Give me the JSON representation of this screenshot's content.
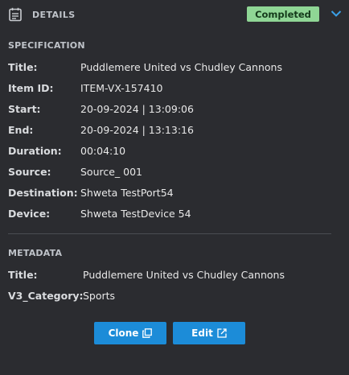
{
  "header": {
    "title": "DETAILS",
    "status": "Completed",
    "icon": "details-document-icon",
    "collapse_icon": "chevron-down-icon"
  },
  "specification": {
    "section_title": "SPECIFICATION",
    "rows": [
      {
        "label": "Title:",
        "value": "Puddlemere United vs Chudley Cannons"
      },
      {
        "label": "Item ID:",
        "value": "ITEM-VX-157410"
      },
      {
        "label": "Start:",
        "value": "20-09-2024 | 13:09:06"
      },
      {
        "label": "End:",
        "value": "20-09-2024 | 13:13:16"
      },
      {
        "label": "Duration:",
        "value": "00:04:10"
      },
      {
        "label": "Source:",
        "value": "Source_ 001"
      },
      {
        "label": "Destination:",
        "value": "Shweta TestPort54"
      },
      {
        "label": "Device:",
        "value": "Shweta TestDevice 54"
      }
    ]
  },
  "metadata": {
    "section_title": "METADATA",
    "rows": [
      {
        "label": "Title:",
        "value": "Puddlemere United vs Chudley Cannons"
      },
      {
        "label": "V3_Category:",
        "value": "Sports"
      }
    ]
  },
  "actions": {
    "clone_label": "Clone",
    "clone_icon": "copy-icon",
    "edit_label": "Edit",
    "edit_icon": "external-edit-icon"
  },
  "colors": {
    "background": "#2b2c30",
    "status_badge": "#8fd695",
    "button": "#1c8cd8",
    "accent": "#1c8cd8"
  }
}
